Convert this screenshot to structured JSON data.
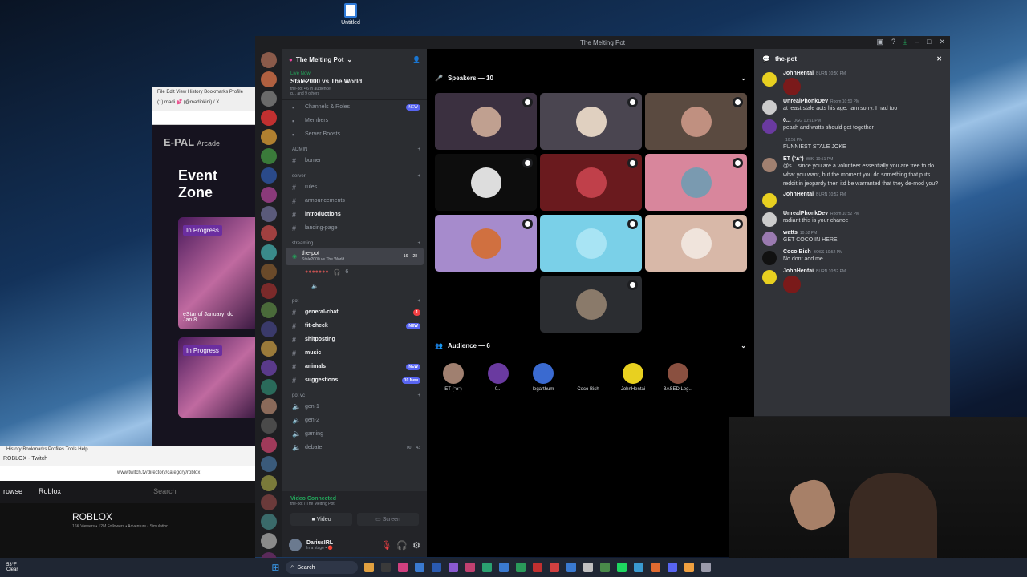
{
  "desktop": {
    "icon_label": "Untitled"
  },
  "bg_browser": {
    "menu": "File  Edit  View  History  Bookmarks  Profile",
    "tab": "(1) madi 💕 (@madiokini) / X",
    "logo": "E-PAL",
    "nav": "Arcade",
    "title": "Event Zone",
    "card1_pill": "In Progress",
    "card1_caption": "eStar of January: do",
    "card1_date": "Jan 8",
    "card2_pill": "In Progress"
  },
  "twitch": {
    "menu": "History  Bookmarks  Profiles  Tools  Help",
    "tab": "ROBLOX - Twitch",
    "url": "www.twitch.tv/directory/category/roblox",
    "nav1": "rowse",
    "nav2": "Roblox",
    "search": "Search",
    "game": "ROBLOX",
    "stats": "16K Viewers • 12M Followers • Adventure • Simulation"
  },
  "window": {
    "title": "The Melting Pot"
  },
  "server": {
    "name": "The Melting Pot",
    "live": "Live Now",
    "event_title": "Stale2000 vs The World",
    "event_sub": "the-pot • 6 in audience",
    "event_sub2": "g... and 9 others"
  },
  "menu_items": [
    {
      "label": "Channels & Roles",
      "badge": "NEW"
    },
    {
      "label": "Members"
    },
    {
      "label": "Server Boosts"
    }
  ],
  "categories": {
    "admin": "ADMIN",
    "server": "server",
    "streaming": "streaming",
    "pot": "pot",
    "potvc": "pot vc"
  },
  "admin_channels": [
    "burner"
  ],
  "server_channels": [
    "rules",
    "announcements",
    "introductions",
    "landing-page"
  ],
  "stream": {
    "name": "the-pot",
    "sub": "Stale2000 vs The World",
    "n1": "16",
    "n2": "28",
    "count": "6"
  },
  "pot_channels": [
    {
      "name": "general-chat",
      "badge": "1"
    },
    {
      "name": "fit-check",
      "badge": "NEW"
    },
    {
      "name": "shitposting"
    },
    {
      "name": "music"
    },
    {
      "name": "animals",
      "badge": "NEW"
    },
    {
      "name": "suggestions",
      "badge": "10 New"
    }
  ],
  "vc_channels": [
    {
      "name": "gen-1"
    },
    {
      "name": "gen-2"
    },
    {
      "name": "gaming"
    },
    {
      "name": "debate",
      "n1": "00",
      "n2": "43"
    }
  ],
  "voice": {
    "status": "Video Connected",
    "sub": "the-pot / The Melting Pot",
    "video": "Video",
    "screen": "Screen"
  },
  "user": {
    "name": "DariusIRL",
    "status": "In a stage • 🔴"
  },
  "stage": {
    "speakers": "Speakers — 10",
    "audience": "Audience — 6"
  },
  "tiles": [
    {
      "bg": "#3b3040",
      "av": "#c0a090"
    },
    {
      "bg": "#4a4550",
      "av": "#e0d0c0"
    },
    {
      "bg": "#5a4a40",
      "av": "#c09080"
    },
    {
      "bg": "#0d0d0d",
      "av": "#dddddd"
    },
    {
      "bg": "#6a1a1e",
      "av": "#c0404a"
    },
    {
      "bg": "#d8869c",
      "av": "#7a9ab0"
    },
    {
      "bg": "#a68bcc",
      "av": "#d07040"
    },
    {
      "bg": "#7ad0e8",
      "av": "#a8e4f4"
    },
    {
      "bg": "#d8b8a8",
      "av": "#f0e4dc"
    },
    {
      "bg": "#2b2d31",
      "av": "#8a7a6a"
    }
  ],
  "audience": [
    {
      "name": "ET (ᵔᴥᵔ)",
      "color": "#a08070"
    },
    {
      "name": "0...",
      "color": "#6a3aa0"
    },
    {
      "name": "legarthum",
      "color": "#3a6ad0"
    },
    {
      "name": "Coco Bish",
      "color": "#000000"
    },
    {
      "name": "JohnHentai",
      "color": "#e8d020"
    },
    {
      "name": "BASED Leg...",
      "color": "#8a5040"
    }
  ],
  "chat": {
    "channel": "the-pot",
    "messages": [
      {
        "author": "JohnHentai",
        "tag": "BURN  10:50 PM",
        "text": "",
        "color": "#e8d020",
        "emoji": true
      },
      {
        "author": "UnrealPhonkDev",
        "tag": "Room  10:50 PM",
        "text": "at least stale acts his age. Iam sorry. I had too",
        "color": "#cccccc"
      },
      {
        "author": "0...",
        "tag": "DGG  10:51 PM",
        "text": "peach and watts should get together",
        "color": "#6a3aa0"
      },
      {
        "author": "",
        "tag": "10:51 PM",
        "text": "FUNNIEST STALE JOKE",
        "color": "#313338"
      },
      {
        "author": "ET (ᵔᴥᵔ)",
        "tag": "WIKI  10:51 PM",
        "text": "@s... since you are a volunteer essentially you are free to do what you want, but the moment you do something that puts reddit in jeopardy then itd be warranted that they de-mod you?",
        "color": "#a08070"
      },
      {
        "author": "JohnHentai",
        "tag": "BURN  10:52 PM",
        "text": "",
        "color": "#e8d020"
      },
      {
        "author": "UnrealPhonkDev",
        "tag": "Room  10:52 PM",
        "text": "radiant this is your chance",
        "color": "#cccccc"
      },
      {
        "author": "watts",
        "tag": "10:52 PM",
        "text": "GET COCO IN HERE",
        "color": "#9a7ab0"
      },
      {
        "author": "Coco Bish",
        "tag": "BOSS  10:52 PM",
        "text": "No dont add me",
        "color": "#111111"
      },
      {
        "author": "JohnHentai",
        "tag": "BURN  10:52 PM",
        "text": "",
        "color": "#e8d020",
        "emoji": true
      }
    ]
  },
  "taskbar": {
    "weather": "53°F",
    "weather2": "Clear",
    "search": "Search"
  }
}
